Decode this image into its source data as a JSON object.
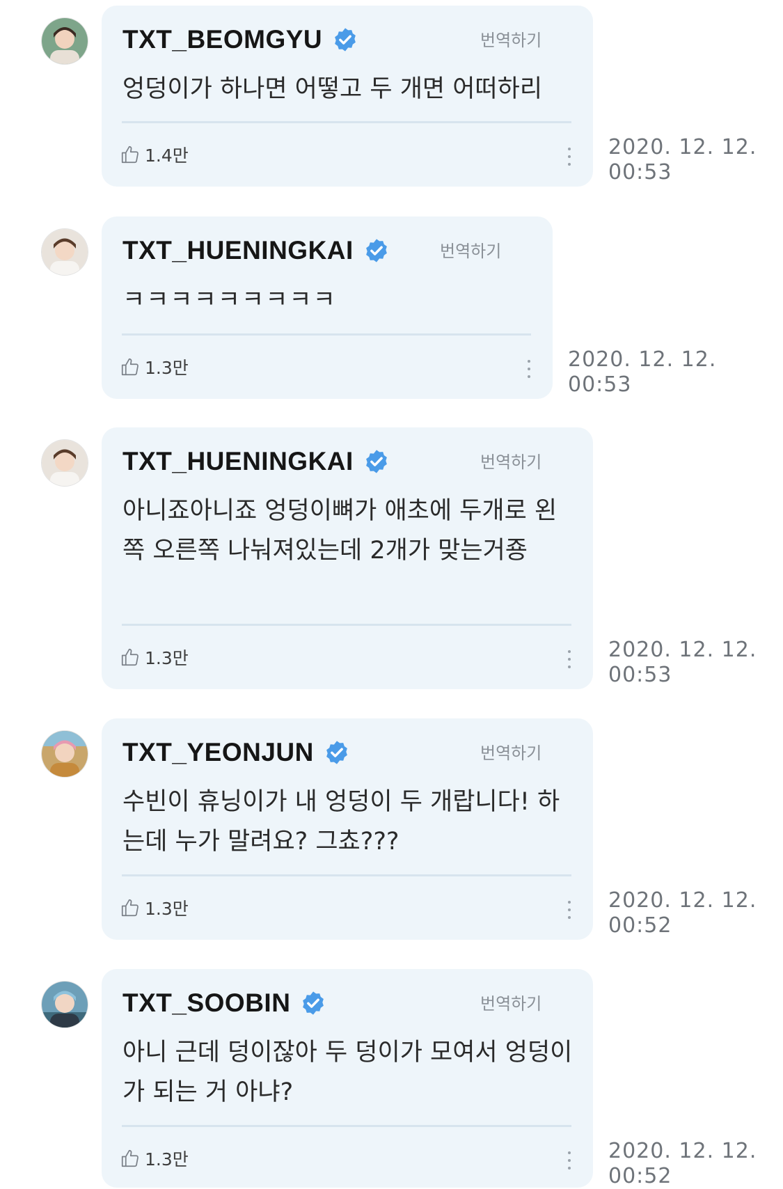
{
  "comments": [
    {
      "username": "TXT_BEOMGYU",
      "translate_label": "번역하기",
      "text": "엉덩이가 하나면 어떻고 두 개면 어떠하리",
      "likes": "1.4만",
      "timestamp_date": "2020. 12. 12.",
      "timestamp_time": "00:53",
      "avatar_color": "#7ea58a"
    },
    {
      "username": "TXT_HUENINGKAI",
      "translate_label": "번역하기",
      "text": "ㅋㅋㅋㅋㅋㅋㅋㅋㅋ",
      "likes": "1.3만",
      "timestamp_date": "2020. 12. 12.",
      "timestamp_time": "00:53",
      "avatar_color": "#d9cfc6"
    },
    {
      "username": "TXT_HUENINGKAI",
      "translate_label": "번역하기",
      "text": "아니죠아니죠 엉덩이뼈가 애초에 두개로 왼쪽 오른쪽 나눠져있는데 2개가 맞는거죵",
      "likes": "1.3만",
      "timestamp_date": "2020. 12. 12.",
      "timestamp_time": "00:53",
      "avatar_color": "#d9cfc6"
    },
    {
      "username": "TXT_YEONJUN",
      "translate_label": "번역하기",
      "text": "수빈이 휴닝이가 내 엉덩이 두 개랍니다! 하는데 누가 말려요? 그쵸???",
      "likes": "1.3만",
      "timestamp_date": "2020. 12. 12.",
      "timestamp_time": "00:52",
      "avatar_color": "#c9a66b"
    },
    {
      "username": "TXT_SOOBIN",
      "translate_label": "번역하기",
      "text": "아니 근데 덩이잖아 두 덩이가 모여서 엉덩이가 되는 거 아냐?",
      "likes": "1.3만",
      "timestamp_date": "2020. 12. 12.",
      "timestamp_time": "00:52",
      "avatar_color": "#6d9fb8"
    }
  ],
  "colors": {
    "bubble_bg": "#eef5fa",
    "verified_badge": "#4a9be8",
    "divider": "#d7e4ee"
  },
  "icons": {
    "verified": "verified-badge-icon",
    "like": "thumbs-up-icon",
    "more": "vertical-ellipsis-icon"
  }
}
